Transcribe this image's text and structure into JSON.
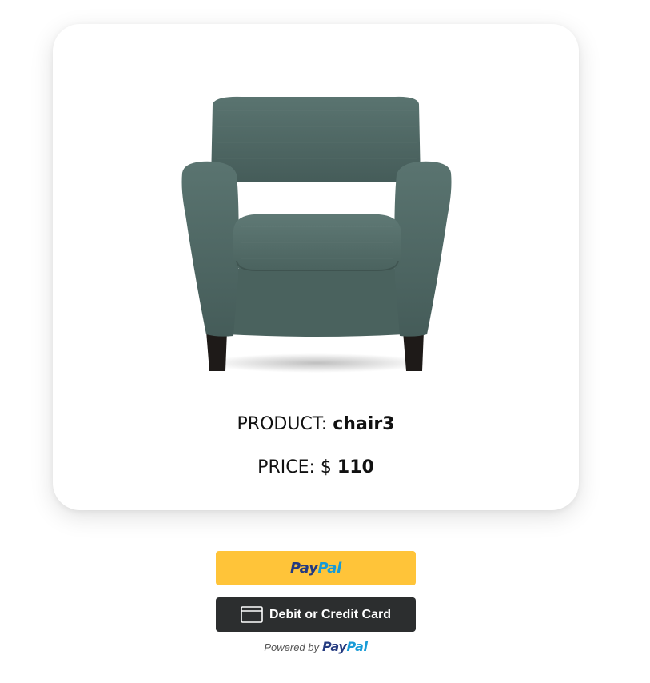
{
  "product": {
    "name_label": "PRODUCT:",
    "name_value": "chair3",
    "price_label": "PRICE: $",
    "price_value": "110",
    "image_icon": "armchair-image",
    "chair_color": "#4d6662"
  },
  "payment": {
    "paypal_pay": "Pay",
    "paypal_pal": "Pal",
    "card_label": "Debit or Credit Card",
    "powered_by": "Powered by",
    "powered_pay": "Pay",
    "powered_pal": "Pal",
    "paypal_button_color": "#ffc439",
    "card_button_color": "#2c2e2f",
    "card_icon": "credit-card-icon"
  }
}
